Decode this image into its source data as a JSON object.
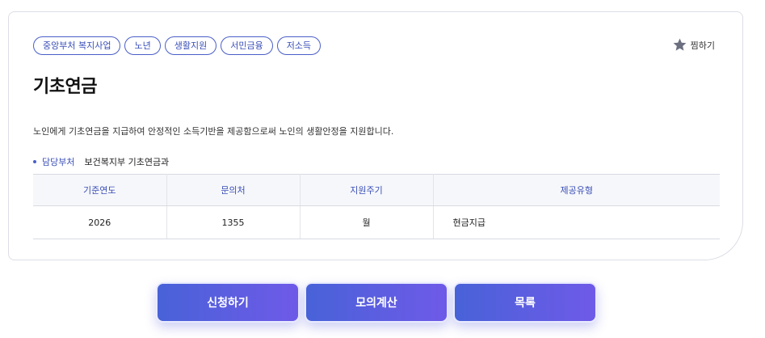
{
  "tags": [
    "중앙부처 복지사업",
    "노년",
    "생활지원",
    "서민금융",
    "저소득"
  ],
  "favorite": {
    "label": "찜하기",
    "icon": "star-icon"
  },
  "title": "기초연금",
  "description": "노인에게 기초연금을 지급하여 안정적인 소득기반을 제공함으로써 노인의 생활안정을 지원합니다.",
  "department": {
    "label": "담당부처",
    "value": "보건복지부 기초연금과"
  },
  "table": {
    "headers": [
      "기준연도",
      "문의처",
      "지원주기",
      "제공유형"
    ],
    "row": [
      "2026",
      "1355",
      "월",
      "현금지급"
    ]
  },
  "buttons": {
    "apply": "신청하기",
    "simulate": "모의계산",
    "list": "목록"
  },
  "colors": {
    "accent": "#3a4fb8",
    "button_start": "#4862d8",
    "button_end": "#6f5ae8"
  }
}
